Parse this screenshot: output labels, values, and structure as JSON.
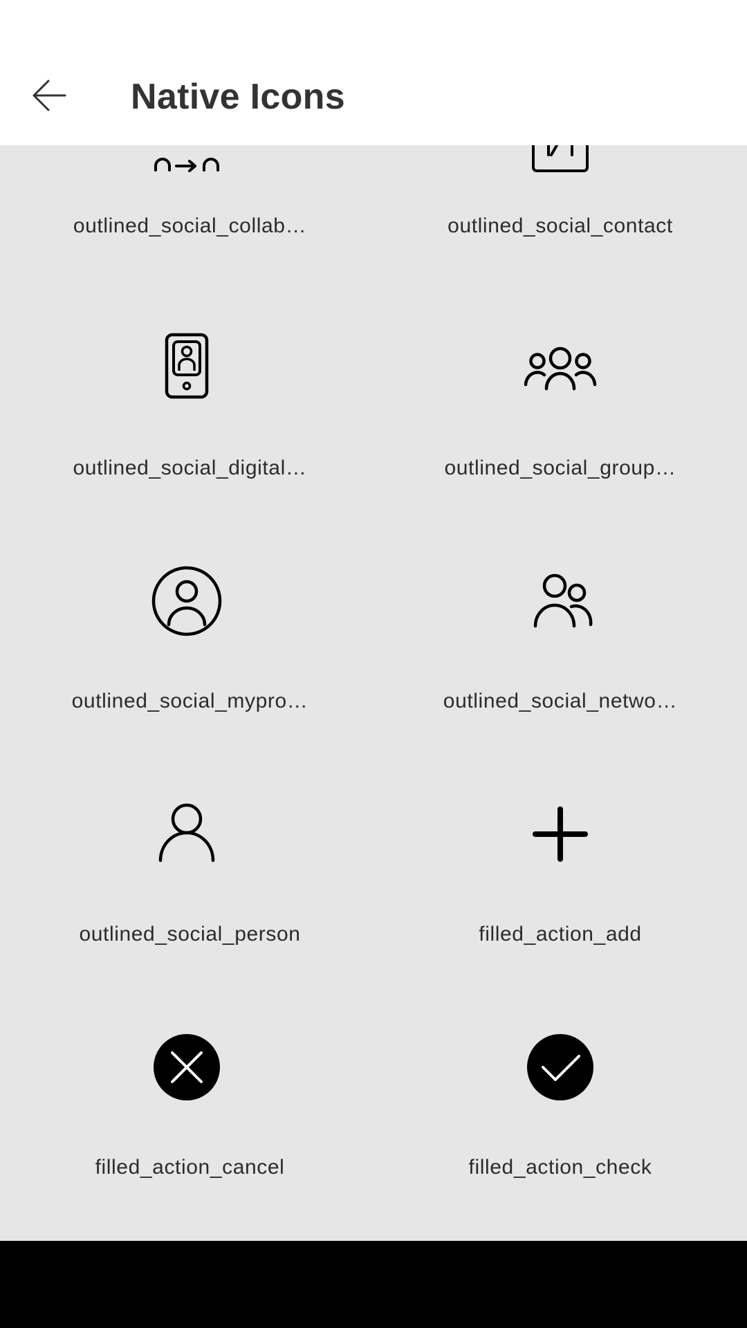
{
  "header": {
    "title": "Native Icons",
    "back_icon": "arrow-left-icon"
  },
  "grid": {
    "items": [
      {
        "label": "outlined_social_collab…",
        "icon": "collaboration-icon"
      },
      {
        "label": "outlined_social_contact",
        "icon": "contact-icon"
      },
      {
        "label": "outlined_social_digital…",
        "icon": "digital-id-phone-icon"
      },
      {
        "label": "outlined_social_group…",
        "icon": "group-icon"
      },
      {
        "label": "outlined_social_mypro…",
        "icon": "my-profile-icon"
      },
      {
        "label": "outlined_social_netwo…",
        "icon": "network-icon"
      },
      {
        "label": "outlined_social_person",
        "icon": "person-icon"
      },
      {
        "label": "filled_action_add",
        "icon": "add-icon"
      },
      {
        "label": "filled_action_cancel",
        "icon": "cancel-icon"
      },
      {
        "label": "filled_action_check",
        "icon": "check-icon"
      }
    ]
  },
  "colors": {
    "app_bar": "#ffffff",
    "background": "#e6e6e6",
    "icon": "#000000",
    "text": "#2b2b2b",
    "nav_bar": "#000000"
  }
}
